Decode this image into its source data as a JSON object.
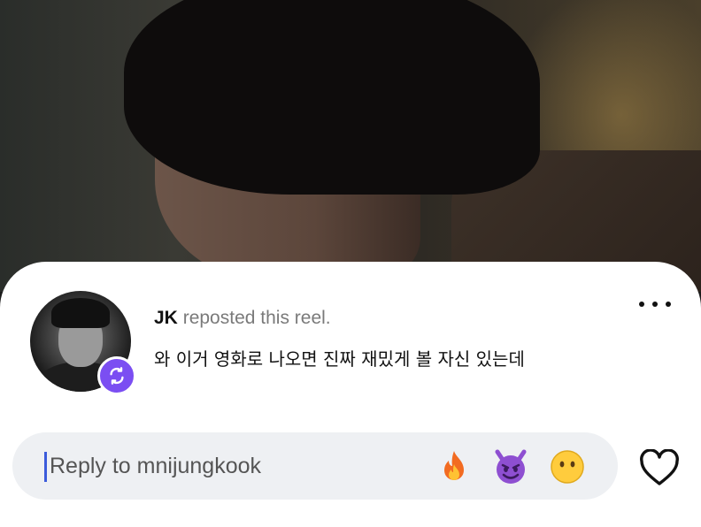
{
  "comment": {
    "username": "JK",
    "action": "reposted this reel.",
    "text": "와 이거 영화로 나오면 진짜 재밌게 볼 자신 있는데"
  },
  "icons": {
    "more": "more-horizontal-icon",
    "repost_badge": "repost-icon",
    "like": "heart-outline-icon"
  },
  "reply": {
    "placeholder": "Reply to mnijungkook",
    "value": ""
  },
  "quick_reactions": [
    {
      "name": "fire-emoji"
    },
    {
      "name": "smiling-devil-emoji"
    },
    {
      "name": "neutral-face-emoji"
    }
  ],
  "colors": {
    "accent": "#7b4ef2",
    "cursor": "#3b5bdb",
    "sheet": "#ffffff",
    "input_bg": "#eef0f3"
  }
}
